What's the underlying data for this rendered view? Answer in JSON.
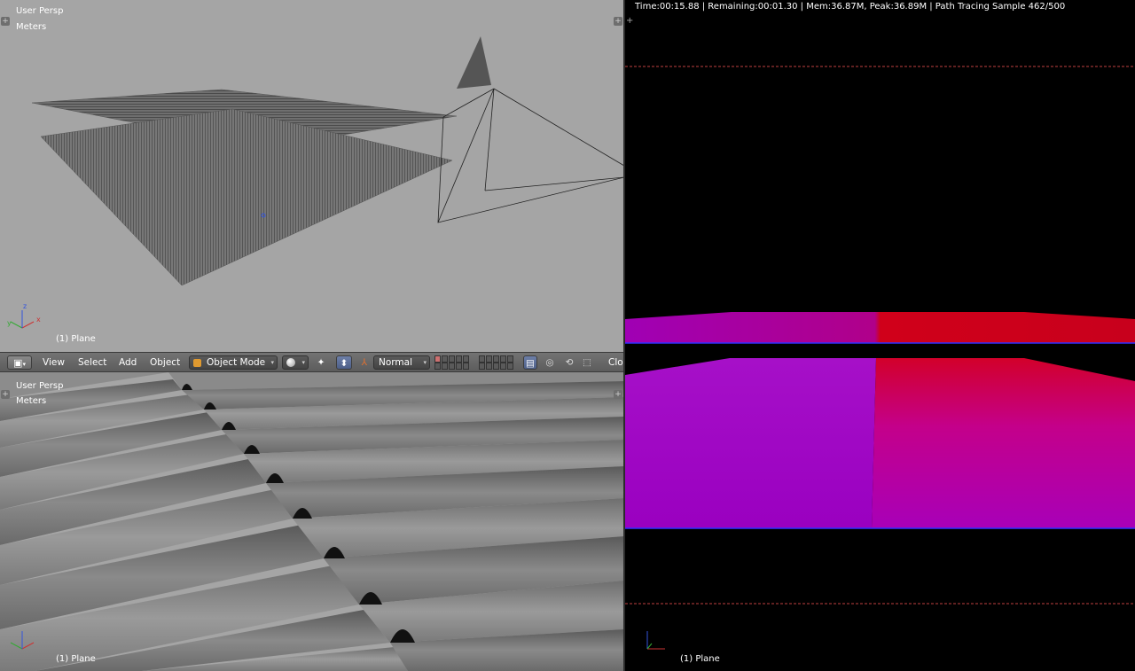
{
  "viewport_top": {
    "view_name": "User Persp",
    "units": "Meters",
    "object_label": "(1) Plane"
  },
  "viewport_bottom": {
    "view_name": "User Persp",
    "units": "Meters",
    "object_label": "(1) Plane"
  },
  "viewport_render": {
    "status": "Time:00:15.88 | Remaining:00:01.30 | Mem:36.87M, Peak:36.89M | Path Tracing Sample 462/500",
    "object_label": "(1) Plane"
  },
  "header": {
    "menu_view": "View",
    "menu_select": "Select",
    "menu_add": "Add",
    "menu_object": "Object",
    "mode": "Object Mode",
    "orientation": "Normal",
    "truncated_label": "Clo"
  },
  "axes": {
    "x": "x",
    "y": "y",
    "z": "z"
  },
  "colors": {
    "viewport_bg": "#a5a5a5",
    "render_bg": "#000000",
    "magenta": "#a000c0",
    "red": "#d00018",
    "axis_x": "#cc3333",
    "axis_y": "#33aa33",
    "axis_z": "#3355dd"
  }
}
